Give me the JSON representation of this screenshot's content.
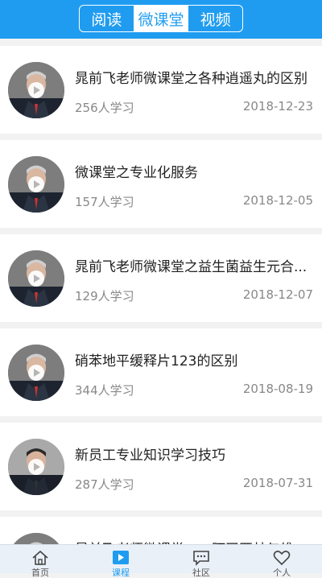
{
  "tabs": [
    {
      "label": "阅读",
      "active": false
    },
    {
      "label": "微课堂",
      "active": true
    },
    {
      "label": "视频",
      "active": false
    }
  ],
  "items": [
    {
      "title": "晁前飞老师微课堂之各种逍遥丸的区别",
      "learners": "256人学习",
      "date": "2018-12-23"
    },
    {
      "title": "微课堂之专业化服务",
      "learners": "157人学习",
      "date": "2018-12-05"
    },
    {
      "title": "晁前飞老师微课堂之益生菌益生元合...",
      "learners": "129人学习",
      "date": "2018-12-07"
    },
    {
      "title": "硝苯地平缓释片123的区别",
      "learners": "344人学习",
      "date": "2018-08-19"
    },
    {
      "title": "新员工专业知识学习技巧",
      "learners": "287人学习",
      "date": "2018-07-31"
    },
    {
      "title": "晁前飞老师微课堂——阿司匹林与维",
      "learners": "",
      "date": ""
    }
  ],
  "bottom_nav": [
    {
      "label": "首页",
      "icon": "home-icon"
    },
    {
      "label": "课程",
      "icon": "play-icon"
    },
    {
      "label": "社区",
      "icon": "chat-icon"
    },
    {
      "label": "个人",
      "icon": "heart-icon"
    }
  ],
  "colors": {
    "accent": "#1f9cf0",
    "background": "#f2f2f2"
  }
}
